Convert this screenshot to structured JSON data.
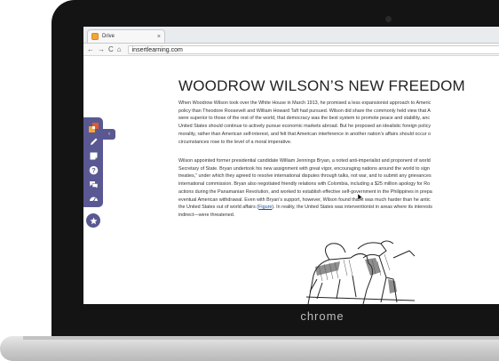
{
  "browser": {
    "tab_title": "Drive",
    "tab_close": "×",
    "url": "insertlearning.com",
    "nav": {
      "back": "←",
      "forward": "→",
      "reload": "C",
      "home": "⌂"
    }
  },
  "brand": "chrome",
  "article": {
    "title": "WOODROW WILSON’S NEW FREEDOM",
    "p1_lines": [
      "When Woodrow Wilson took over the White House in March 1913, he promised a less expansionist approach to Americ",
      "policy than Theodore Roosevelt and William Howard Taft had pursued. Wilson did share the commonly held view that A",
      "were superior to those of the rest of the world, that democracy was the best system to promote peace and stability, anc",
      "United States should continue to actively pursue economic markets abroad. But he proposed an idealistic foreign policy",
      "morality, rather than American self-interest, and felt that American interference in another nation’s affairs should occur o",
      "circumstances rose to the level of a moral imperative."
    ],
    "p2_lines": [
      "Wilson appointed former presidential candidate William Jennings Bryan, a noted anti-imperialist and proponent of world",
      "Secretary of State. Bryan undertook his new assignment with great vigor, encouraging nations around the world to sign",
      "treaties,” under which they agreed to resolve international disputes through talks, not war, and to submit any grievances",
      "international commission. Bryan also negotiated friendly relations with Colombia, including a $25 million apology for Ro",
      "actions during the Panamanian Revolution, and worked to establish effective self-government in the Philippines in prepa",
      "eventual American withdrawal. Even with Bryan’s support, however, Wilson found that it was much harder than he antic"
    ],
    "p2_line7_before": "the United States out of world affairs (",
    "p2_line7_link": "Figure",
    "p2_line7_after": "). In reality, the United States was interventionist in areas where its interests",
    "p2_line8": "indirect—were threatened."
  },
  "sidebar": {
    "icons": [
      "insertlearning-logo-icon",
      "pencil-icon",
      "sticky-note-icon",
      "question-icon",
      "discussion-icon",
      "dashboard-icon"
    ],
    "expand_label": "‹",
    "star_icon": "star-icon"
  },
  "colors": {
    "sidebar_purple": "#5a5892",
    "logo_orange": "#f3a536",
    "link_blue": "#1a4fa0"
  }
}
